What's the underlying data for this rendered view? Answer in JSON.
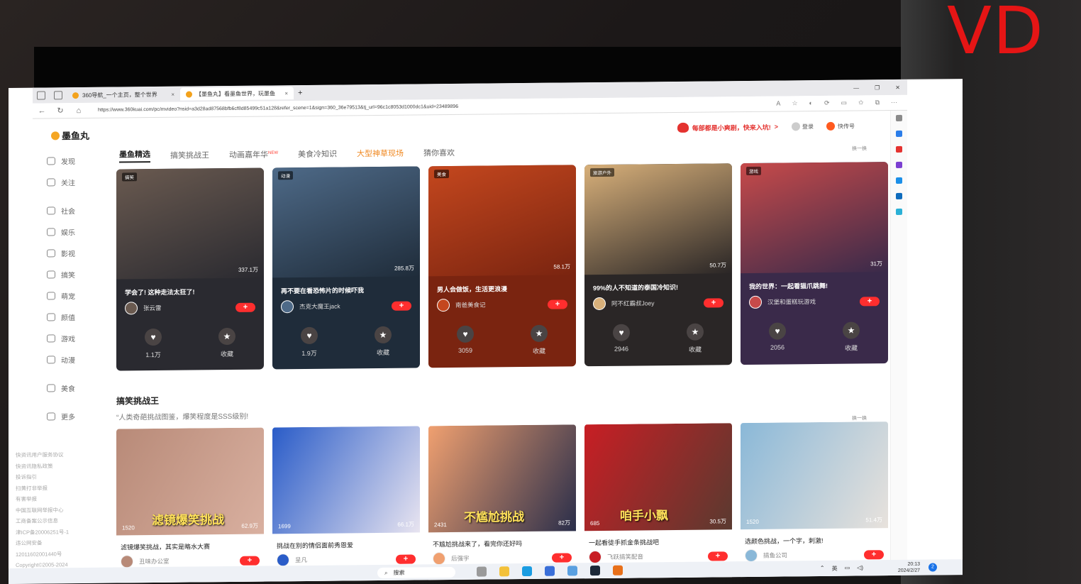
{
  "watermark": "VD",
  "browser": {
    "tabs": [
      {
        "label": "360导航_一个主页，整个世界",
        "active": false
      },
      {
        "label": "【墨鱼丸】看墨鱼世界，玩墨鱼",
        "active": true
      }
    ],
    "url": "https://www.360kuai.com/pc/mvideo?nsid=a3d28ad87568bfb6cf8d85499c51a128&refer_scene=1&sign=360_36e79513&tj_url=96c1c8053d1000dc1&uid=23489896"
  },
  "site": {
    "logo": "墨鱼丸",
    "promo": "每部都是小爽剧，快来入坑!",
    "promo_arrow": ">",
    "login": "登录",
    "kuaichuan": "快传号"
  },
  "sidebar": {
    "items": [
      {
        "label": "发现",
        "icon": "discover-icon"
      },
      {
        "label": "关注",
        "icon": "follow-icon"
      },
      {
        "label": "社会",
        "icon": "society-icon"
      },
      {
        "label": "娱乐",
        "icon": "entertainment-icon"
      },
      {
        "label": "影视",
        "icon": "film-icon"
      },
      {
        "label": "搞笑",
        "icon": "funny-icon"
      },
      {
        "label": "萌宠",
        "icon": "pet-icon"
      },
      {
        "label": "颜值",
        "icon": "beauty-icon"
      },
      {
        "label": "游戏",
        "icon": "game-icon"
      },
      {
        "label": "动漫",
        "icon": "anime-icon"
      },
      {
        "label": "美食",
        "icon": "food-icon"
      },
      {
        "label": "更多",
        "icon": "more-icon"
      }
    ],
    "links": [
      "快资讯用户服务协议",
      "快资讯隐私政策",
      "投诉指引",
      "扫黄打非举报",
      "有害举报",
      "中国互联网举报中心",
      "工商备案公示信息",
      "津ICP备20006251号-1",
      "违公网安备",
      "12011602001440号",
      "Copyright©2005-2024"
    ]
  },
  "main": {
    "tabs": [
      {
        "label": "墨鱼精选",
        "state": "active"
      },
      {
        "label": "搞笑挑战王",
        "state": ""
      },
      {
        "label": "动画嘉年华",
        "state": "",
        "badge": "NEW"
      },
      {
        "label": "美食冷知识",
        "state": ""
      },
      {
        "label": "大型神草现场",
        "state": "orange"
      },
      {
        "label": "猜你喜欢",
        "state": ""
      }
    ],
    "refresh": "换一换",
    "featured": [
      {
        "tag": "搞笑",
        "plays": "337.1万",
        "title": "学会了! 这种走法太狂了!",
        "author": "张云雷",
        "likes": "1.1万",
        "collect": "收藏",
        "c1": "#6a5a50",
        "c2": "#2a2a30"
      },
      {
        "tag": "动漫",
        "plays": "285.8万",
        "title": "再不要在看恐怖片的时候吓我",
        "author": "杰克大魔王jack",
        "likes": "1.9万",
        "collect": "收藏",
        "c1": "#4e6a88",
        "c2": "#1f2c3a"
      },
      {
        "tag": "美食",
        "plays": "58.1万",
        "title": "男人会做饭，生活更浪漫",
        "author": "南爸美食记",
        "likes": "3059",
        "collect": "收藏",
        "c1": "#c4471e",
        "c2": "#7a2410"
      },
      {
        "tag": "旅游户外",
        "plays": "50.7万",
        "title": "99%的人不知道的泰国冷知识!",
        "author": "阿不红霸叔Joey",
        "likes": "2946",
        "collect": "收藏",
        "c1": "#d8b07a",
        "c2": "#2a2626"
      },
      {
        "tag": "游戏",
        "plays": "31万",
        "title": "我的世界：一起看猫爪跳舞!",
        "author": "汉堡和蛋糕玩游戏",
        "likes": "2056",
        "collect": "收藏",
        "c1": "#c74a4a",
        "c2": "#3a2a4a"
      }
    ],
    "section": {
      "title": "搞笑挑战王",
      "subtitle": "“人类奇葩挑战图鉴，爆笑程度是SSS级别!",
      "refresh": "换一换",
      "videos": [
        {
          "likes": "1520",
          "plays": "62.9万",
          "overlay": "滤镜爆笑挑战",
          "title": "滤镜爆笑挑战，其实是略水大赛",
          "author": "丑味办公室",
          "c1": "#b88a78",
          "c2": "#d9b0a0"
        },
        {
          "likes": "1699",
          "plays": "66.1万",
          "overlay": "",
          "title": "挑战在别的情侣面前秀恩爱",
          "author": "呈凡",
          "c1": "#2a5cc8",
          "c2": "#e8e4f0"
        },
        {
          "likes": "2431",
          "plays": "82万",
          "overlay": "不尴尬挑战",
          "title": "不尴尬挑战来了，看完你还好吗",
          "author": "后强宇",
          "c1": "#f0a070",
          "c2": "#2a2e4a"
        },
        {
          "likes": "685",
          "plays": "30.5万",
          "overlay": "咱手小飘",
          "title": "一起看徒手抓金条挑战吧",
          "author": "飞跃搞笑配音",
          "c1": "#c81e24",
          "c2": "#5a3a30"
        },
        {
          "likes": "1520",
          "plays": "51.4万",
          "overlay": "",
          "title": "选颜色挑战，一个字，刺激!",
          "author": "搞鱼公司",
          "c1": "#8ab8d8",
          "c2": "#e8e2dc"
        }
      ]
    }
  },
  "taskbar": {
    "search": "搜索",
    "lang": "英",
    "time": "20:13",
    "date": "2024/2/27",
    "notifications": "2"
  }
}
